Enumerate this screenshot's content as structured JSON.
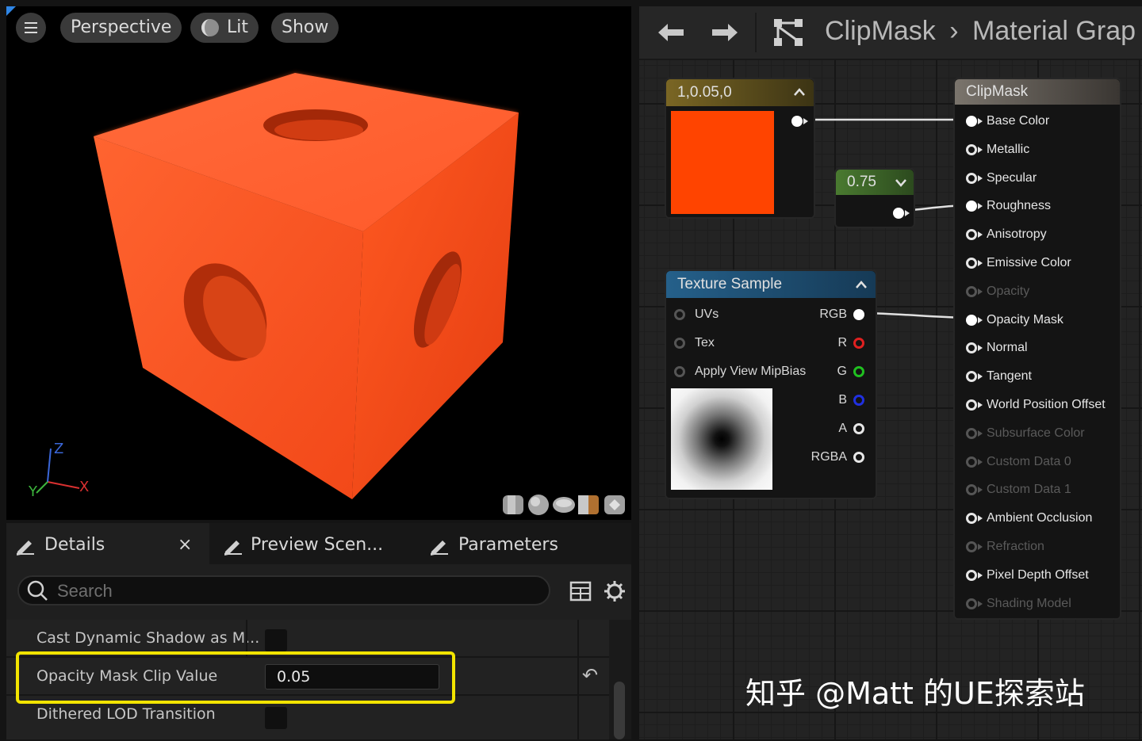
{
  "viewport": {
    "menu_icon": "hamburger-icon",
    "perspective_label": "Perspective",
    "lit_label": "Lit",
    "show_label": "Show",
    "axis_x": "X",
    "axis_y": "Y",
    "axis_z": "Z"
  },
  "details": {
    "tabs": [
      {
        "label": "Details",
        "icon": "pencil-icon"
      },
      {
        "label": "Preview Scen...",
        "icon": "pencil-icon"
      },
      {
        "label": "Parameters",
        "icon": "pencil-icon"
      }
    ],
    "close_glyph": "×",
    "search_placeholder": "Search",
    "rows": [
      {
        "label": "Cast Dynamic Shadow as M..."
      },
      {
        "label": "Opacity Mask Clip Value",
        "value": "0.05"
      },
      {
        "label": "Dithered LOD Transition"
      }
    ],
    "reset_glyph": "↶",
    "highlight_color": "#f2e400"
  },
  "graph": {
    "breadcrumb": [
      "ClipMask",
      "Material Grap"
    ],
    "breadcrumb_sep": "›",
    "color_node": {
      "title": "1,0.05,0",
      "swatch_color": "#ff4400",
      "header_color": "#6e5c1c"
    },
    "scalar_node": {
      "title": "0.75",
      "header_color": "#3e6a2a"
    },
    "texture_node": {
      "title": "Texture Sample",
      "header_color": "#1d4f74",
      "inputs": [
        "UVs",
        "Tex",
        "Apply View MipBias"
      ],
      "outputs": [
        "RGB",
        "R",
        "G",
        "B",
        "A",
        "RGBA"
      ]
    },
    "material_node": {
      "title": "ClipMask",
      "pins": [
        {
          "label": "Base Color",
          "state": "connected"
        },
        {
          "label": "Metallic",
          "state": "active"
        },
        {
          "label": "Specular",
          "state": "active"
        },
        {
          "label": "Roughness",
          "state": "connected"
        },
        {
          "label": "Anisotropy",
          "state": "active"
        },
        {
          "label": "Emissive Color",
          "state": "active"
        },
        {
          "label": "Opacity",
          "state": "disabled"
        },
        {
          "label": "Opacity Mask",
          "state": "connected"
        },
        {
          "label": "Normal",
          "state": "active"
        },
        {
          "label": "Tangent",
          "state": "active"
        },
        {
          "label": "World Position Offset",
          "state": "active"
        },
        {
          "label": "Subsurface Color",
          "state": "disabled"
        },
        {
          "label": "Custom Data 0",
          "state": "disabled"
        },
        {
          "label": "Custom Data 1",
          "state": "disabled"
        },
        {
          "label": "Ambient Occlusion",
          "state": "active"
        },
        {
          "label": "Refraction",
          "state": "disabled"
        },
        {
          "label": "Pixel Depth Offset",
          "state": "active"
        },
        {
          "label": "Shading Model",
          "state": "disabled"
        }
      ]
    }
  },
  "watermark": "知乎 @Matt 的UE探索站"
}
